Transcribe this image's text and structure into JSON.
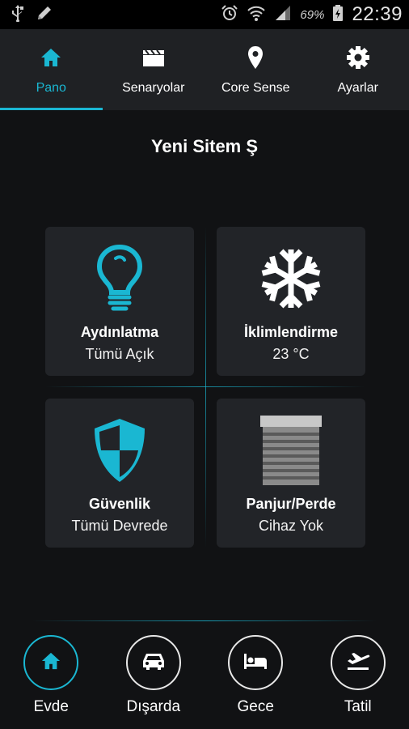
{
  "status_bar": {
    "battery_percent": "69%",
    "time": "22:39",
    "icons": [
      "usb-icon",
      "pencil-icon",
      "alarm-icon",
      "wifi-icon",
      "signal-icon",
      "battery-charging-icon"
    ]
  },
  "top_tabs": [
    {
      "label": "Pano",
      "icon": "home-icon",
      "active": true
    },
    {
      "label": "Senaryolar",
      "icon": "clapperboard-icon",
      "active": false
    },
    {
      "label": "Core Sense",
      "icon": "location-pin-icon",
      "active": false
    },
    {
      "label": "Ayarlar",
      "icon": "gear-icon",
      "active": false
    }
  ],
  "site": {
    "title": "Yeni Sitem Ş"
  },
  "tiles": [
    {
      "title": "Aydınlatma",
      "status": "Tümü Açık",
      "icon": "lightbulb-icon"
    },
    {
      "title": "İklimlendirme",
      "status": "23 °C",
      "icon": "snowflake-icon"
    },
    {
      "title": "Güvenlik",
      "status": "Tümü Devrede",
      "icon": "shield-icon"
    },
    {
      "title": "Panjur/Perde",
      "status": "Cihaz Yok",
      "icon": "shutter-icon"
    }
  ],
  "modes": [
    {
      "label": "Evde",
      "icon": "home-icon",
      "active": true
    },
    {
      "label": "Dışarda",
      "icon": "car-icon",
      "active": false
    },
    {
      "label": "Gece",
      "icon": "bed-icon",
      "active": false
    },
    {
      "label": "Tatil",
      "icon": "plane-departure-icon",
      "active": false
    }
  ],
  "colors": {
    "accent": "#1ab7d2",
    "background": "#111214",
    "tile": "#222428",
    "topbar": "#1f2124"
  }
}
